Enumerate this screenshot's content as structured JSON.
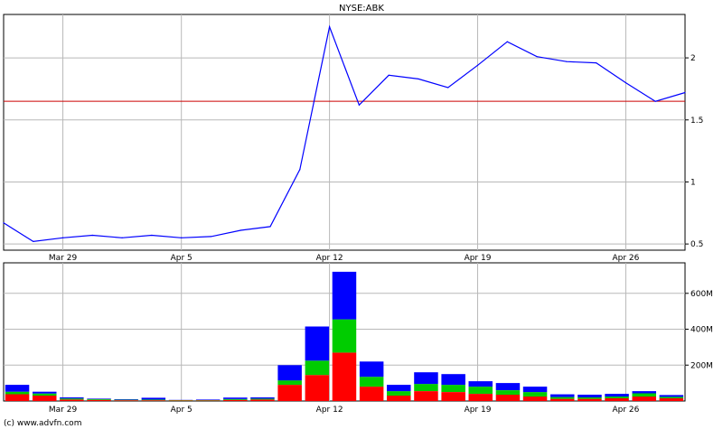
{
  "header": {
    "symbol": "NYSE:ABK"
  },
  "footer": {
    "credit": "(c) www.advfn.com"
  },
  "colors": {
    "price_line": "#0000ff",
    "reference_line": "#cc0000",
    "grid": "#b8b8b8",
    "frame": "#000000",
    "vol_top": "#0000ff",
    "vol_mid": "#00cc00",
    "vol_bottom": "#ff0000"
  },
  "chart_data": [
    {
      "type": "line",
      "title": "NYSE:ABK",
      "x_tick_labels": [
        "Mar 29",
        "Apr 5",
        "Apr 12",
        "Apr 19",
        "Apr 26"
      ],
      "x_tick_index": [
        2,
        6,
        11,
        16,
        21
      ],
      "y_tick_labels": [
        "0.5",
        "1",
        "1.5",
        "2"
      ],
      "y_ticks": [
        0.5,
        1,
        1.5,
        2
      ],
      "ylim": [
        0.45,
        2.35
      ],
      "grid": true,
      "reference_line": 1.65,
      "values": [
        0.67,
        0.52,
        0.55,
        0.57,
        0.55,
        0.57,
        0.55,
        0.56,
        0.61,
        0.64,
        1.1,
        2.25,
        1.62,
        1.86,
        1.83,
        1.76,
        1.94,
        2.13,
        2.01,
        1.97,
        1.96,
        1.8,
        1.65,
        1.72
      ]
    },
    {
      "type": "bar",
      "stacked": true,
      "x_tick_labels": [
        "Mar 29",
        "Apr 5",
        "Apr 12",
        "Apr 19",
        "Apr 26"
      ],
      "x_tick_index": [
        2,
        6,
        11,
        16,
        21
      ],
      "y_tick_labels": [
        "200M",
        "400M",
        "600M"
      ],
      "y_ticks": [
        200,
        400,
        600
      ],
      "ylim": [
        0,
        770
      ],
      "grid": true,
      "series": [
        {
          "values": [
            38,
            30,
            8,
            6,
            4,
            4,
            3,
            3,
            6,
            8,
            90,
            145,
            270,
            80,
            30,
            55,
            50,
            40,
            35,
            25,
            12,
            12,
            15,
            25,
            15
          ]
        },
        {
          "values": [
            14,
            12,
            6,
            4,
            3,
            4,
            2,
            2,
            5,
            5,
            25,
            80,
            185,
            55,
            25,
            40,
            40,
            40,
            25,
            25,
            10,
            8,
            10,
            18,
            8
          ]
        },
        {
          "values": [
            38,
            10,
            6,
            3,
            3,
            10,
            1,
            3,
            8,
            7,
            85,
            190,
            265,
            85,
            35,
            65,
            60,
            30,
            40,
            30,
            15,
            15,
            15,
            12,
            10
          ]
        }
      ]
    }
  ]
}
